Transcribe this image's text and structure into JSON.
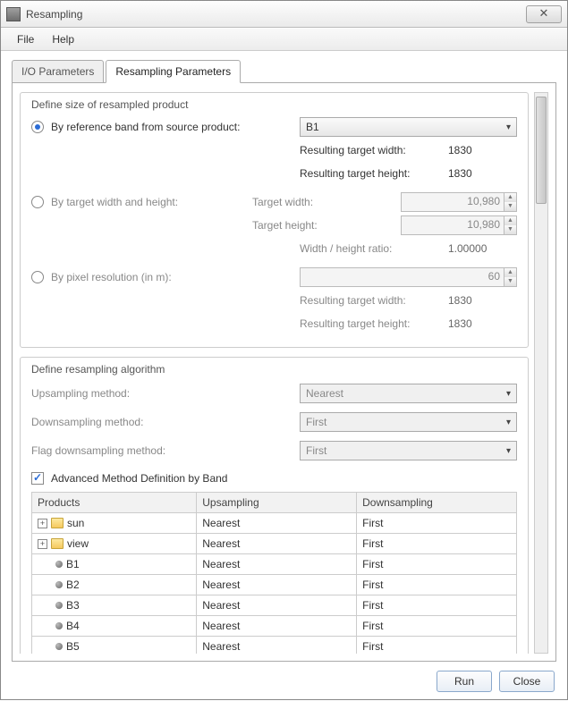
{
  "window": {
    "title": "Resampling"
  },
  "menu": {
    "file": "File",
    "help": "Help"
  },
  "tabs": {
    "io": "I/O Parameters",
    "resampling": "Resampling Parameters"
  },
  "size_group": {
    "title": "Define size of resampled product",
    "by_ref": {
      "label": "By reference band from source product:",
      "selected_band": "B1",
      "rtw_label": "Resulting target width:",
      "rtw_value": "1830",
      "rth_label": "Resulting target height:",
      "rth_value": "1830"
    },
    "by_wh": {
      "label": "By target width and height:",
      "tw_label": "Target width:",
      "tw_value": "10,980",
      "th_label": "Target height:",
      "th_value": "10,980",
      "ratio_label": "Width / height ratio:",
      "ratio_value": "1.00000"
    },
    "by_res": {
      "label": "By pixel resolution (in m):",
      "value": "60",
      "rtw_label": "Resulting target width:",
      "rtw_value": "1830",
      "rth_label": "Resulting target height:",
      "rth_value": "1830"
    }
  },
  "algo_group": {
    "title": "Define resampling algorithm",
    "up_label": "Upsampling method:",
    "up_value": "Nearest",
    "down_label": "Downsampling method:",
    "down_value": "First",
    "flag_label": "Flag downsampling method:",
    "flag_value": "First",
    "adv_label": "Advanced Method Definition by Band",
    "table": {
      "headers": {
        "products": "Products",
        "up": "Upsampling",
        "down": "Downsampling"
      },
      "rows": [
        {
          "type": "folder",
          "name": "sun",
          "up": "Nearest",
          "down": "First"
        },
        {
          "type": "folder",
          "name": "view",
          "up": "Nearest",
          "down": "First"
        },
        {
          "type": "band",
          "name": "B1",
          "up": "Nearest",
          "down": "First"
        },
        {
          "type": "band",
          "name": "B2",
          "up": "Nearest",
          "down": "First"
        },
        {
          "type": "band",
          "name": "B3",
          "up": "Nearest",
          "down": "First"
        },
        {
          "type": "band",
          "name": "B4",
          "up": "Nearest",
          "down": "First"
        },
        {
          "type": "band",
          "name": "B5",
          "up": "Nearest",
          "down": "First"
        }
      ]
    }
  },
  "buttons": {
    "run": "Run",
    "close": "Close"
  }
}
